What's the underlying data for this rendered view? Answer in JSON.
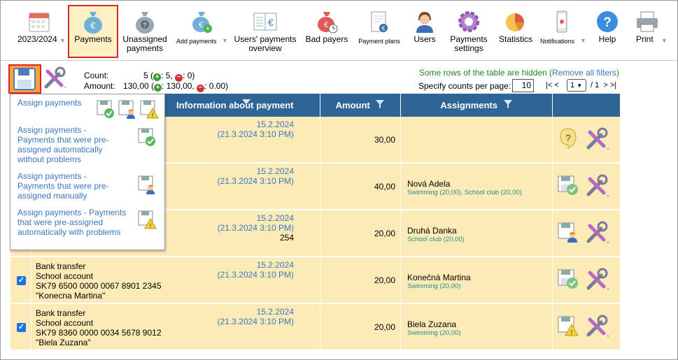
{
  "toolbar": {
    "items": [
      {
        "label": "2023/2024",
        "icon": "calendar-icon"
      },
      {
        "label": "Payments",
        "icon": "money-bag-euro-icon"
      },
      {
        "label": "Unassigned payments",
        "icon": "money-bag-question-icon"
      },
      {
        "label": "Add payments",
        "icon": "money-bag-add-icon"
      },
      {
        "label": "Users' payments overview",
        "icon": "ledger-euro-icon"
      },
      {
        "label": "Bad payers",
        "icon": "money-bag-bad-icon"
      },
      {
        "label": "Payment plans",
        "icon": "document-euro-icon"
      },
      {
        "label": "Users",
        "icon": "user-icon"
      },
      {
        "label": "Payments settings",
        "icon": "gear-icon"
      },
      {
        "label": "Statistics",
        "icon": "pie-chart-icon"
      },
      {
        "label": "Notifications",
        "icon": "phone-icon"
      },
      {
        "label": "Help",
        "icon": "help-icon"
      },
      {
        "label": "Print",
        "icon": "printer-icon"
      }
    ]
  },
  "counts": {
    "count_label": "Count:",
    "count_value": "5",
    "count_plus": "5",
    "count_minus": "0",
    "amount_label": "Amount:",
    "amount_value": "130,00",
    "amount_plus": "130,00",
    "amount_minus": "0.00"
  },
  "filter_note": {
    "text": "Some rows of the table are hidden",
    "link": "Remove all filters"
  },
  "pagination": {
    "per_page_label": "Specify counts per page:",
    "per_page_value": "10",
    "first": "|<",
    "prev": "<",
    "page": "1",
    "of": "/ 1",
    "next": ">",
    "last": ">|"
  },
  "table": {
    "headers": {
      "info": "Information about payment",
      "amount": "Amount",
      "assignments": "Assignments"
    },
    "rows": [
      {
        "desc": [
          "",
          "",
          "",
          ""
        ],
        "date": "15.2.2024",
        "datetime": "(21.3.2024 3:10 PM)",
        "extra": "",
        "amount": "30,00",
        "name": "",
        "detail": "",
        "checked": false,
        "status": "question"
      },
      {
        "desc": [
          "",
          "",
          "",
          ""
        ],
        "date": "15.2.2024",
        "datetime": "(21.3.2024 3:10 PM)",
        "extra": "",
        "amount": "40,00",
        "name": "Nová Adela",
        "detail": "Swimming (20,00), School club (20,00)",
        "checked": false,
        "status": "ok"
      },
      {
        "desc": [
          "",
          "",
          "",
          ""
        ],
        "date": "15.2.2024",
        "datetime": "(21.3.2024 3:10 PM)",
        "extra": "254",
        "amount": "20,00",
        "name": "Druhá Danka",
        "detail": "School club (20,00)",
        "checked": false,
        "status": "manual"
      },
      {
        "desc": [
          "Bank transfer",
          "School account",
          "SK79 6500 0000 0067 8901 2345",
          "\"Konecna Martina\""
        ],
        "date": "15.2.2024",
        "datetime": "(21.3.2024 3:10 PM)",
        "extra": "",
        "amount": "20,00",
        "name": "Konečná Martina",
        "detail": "Swimming (20,00)",
        "checked": true,
        "status": "ok"
      },
      {
        "desc": [
          "Bank transfer",
          "School account",
          "SK79 8360 0000 0034 5678 9012",
          "\"Biela Zuzana\""
        ],
        "date": "15.2.2024",
        "datetime": "(21.3.2024 3:10 PM)",
        "extra": "",
        "amount": "20,00",
        "name": "Biela Zuzana",
        "detail": "Swimming (20,00)",
        "checked": true,
        "status": "warn"
      }
    ]
  },
  "dropdown": {
    "items": [
      {
        "label": "Assign payments"
      },
      {
        "label": "Assign payments - Payments that were pre-assigned automatically without problems"
      },
      {
        "label": "Assign payments - Payments that were pre-assigned manually"
      },
      {
        "label": "Assign payments - Payments that were pre-assigned automatically with problems"
      }
    ]
  },
  "colors": {
    "header_bg": "#2f6496",
    "row_bg": "#fcebb6",
    "link": "#3a78c3",
    "accent_red": "#d8262b"
  }
}
